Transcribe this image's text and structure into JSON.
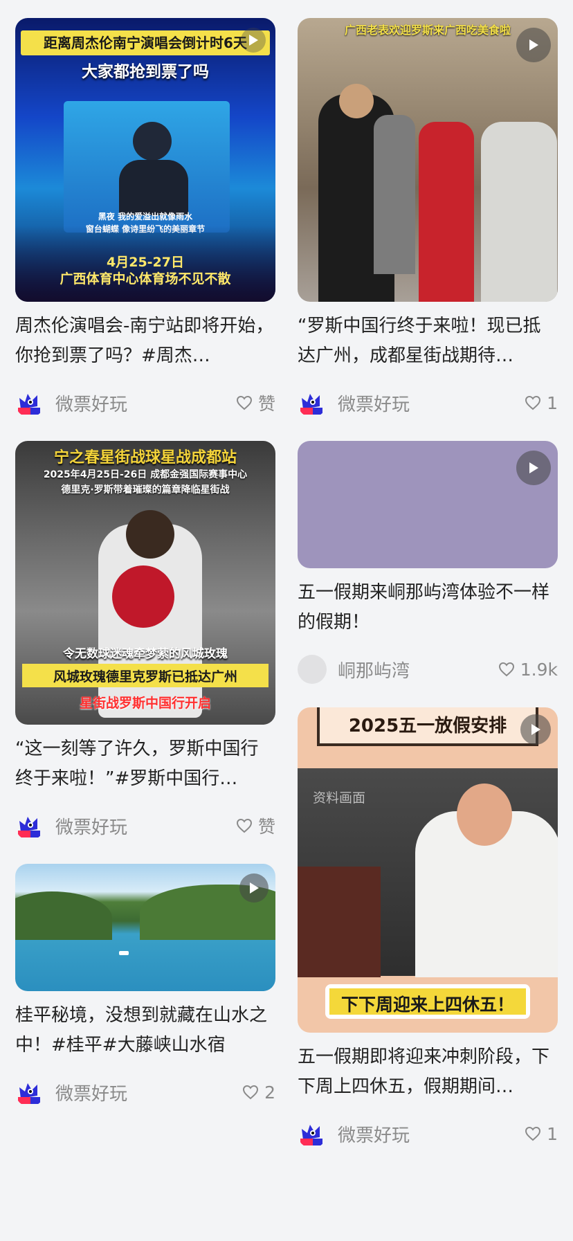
{
  "colors": {
    "background": "#f3f4f6",
    "meta_text": "#8a8a8a",
    "title_text": "#222222"
  },
  "cards": [
    {
      "id": "c1",
      "thumb_overlay": {
        "banner": "距离周杰伦南宁演唱会倒计时6天",
        "headline": "大家都抢到票了吗",
        "lyrics_1": "黑夜 我的爱溢出就像雨水",
        "lyrics_2": "窗台蝴蝶 像诗里纷飞的美丽章节",
        "date": "4月25-27日",
        "venue": "广西体育中心体育场不见不散"
      },
      "title": "周杰伦演唱会-南宁站即将开始，你抢到票了吗？#周杰…",
      "author": "微票好玩",
      "likes": "赞",
      "avatar": "weipiao-mascot-icon"
    },
    {
      "id": "c2",
      "thumb_overlay": {
        "banner": "广西老表欢迎罗斯来广西吃美食啦"
      },
      "title": "“罗斯中国行终于来啦！现已抵达广州，成都星街战期待…",
      "author": "微票好玩",
      "likes": "1",
      "avatar": "weipiao-mascot-icon"
    },
    {
      "id": "c3",
      "thumb_overlay": {
        "banner": "宁之春星街战球星战成都站",
        "sub1": "2025年4月25日-26日 成都金强国际赛事中心",
        "sub2": "德里克·罗斯带着璀璨的篇章降临星街战",
        "mid": "令无数球迷魂牵梦萦的风城玫瑰",
        "yellow": "风城玫瑰德里克罗斯已抵达广州",
        "red": "星街战罗斯中国行开启"
      },
      "title": "“这一刻等了许久，罗斯中国行终于来啦！”#罗斯中国行…",
      "author": "微票好玩",
      "likes": "赞",
      "avatar": "weipiao-mascot-icon"
    },
    {
      "id": "c4",
      "thumb_overlay": {},
      "title": "五一假期来峒那屿湾体验不一样的假期！",
      "author": "峒那屿湾",
      "likes": "1.9k",
      "avatar": "default-avatar-icon"
    },
    {
      "id": "c5",
      "thumb_overlay": {},
      "title": "桂平秘境，没想到就藏在山水之中！#桂平#大藤峡山水宿",
      "author": "微票好玩",
      "likes": "2",
      "avatar": "weipiao-mascot-icon"
    },
    {
      "id": "c6",
      "thumb_overlay": {
        "top": "2025五一放假安排",
        "watermark": "资料画面",
        "bottom": "下下周迎来上四休五！"
      },
      "title": "五一假期即将迎来冲刺阶段，下下周上四休五，假期期间…",
      "author": "微票好玩",
      "likes": "1",
      "avatar": "weipiao-mascot-icon"
    }
  ]
}
